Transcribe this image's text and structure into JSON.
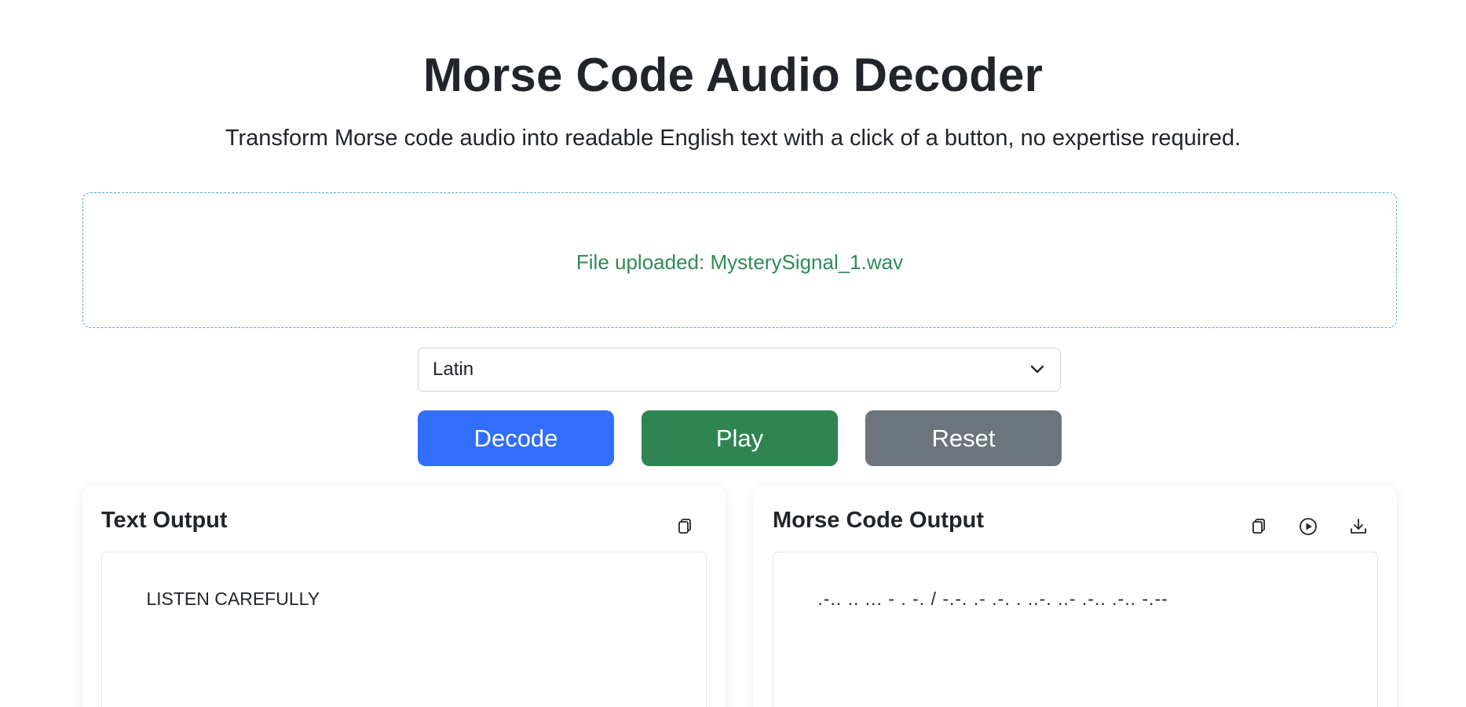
{
  "header": {
    "title": "Morse Code Audio Decoder",
    "subtitle": "Transform Morse code audio into readable English text with a click of a button, no expertise required."
  },
  "upload": {
    "status_text": "File uploaded: MysterySignal_1.wav",
    "status_color": "#2e8b57",
    "border_color": "#58a6e6"
  },
  "language_select": {
    "selected": "Latin",
    "icon": "chevron-down-icon"
  },
  "actions": {
    "decode_label": "Decode",
    "play_label": "Play",
    "reset_label": "Reset",
    "decode_color": "#316ffb",
    "play_color": "#2e8551",
    "reset_color": "#6c757d"
  },
  "text_output": {
    "title": "Text Output",
    "value": "LISTEN CAREFULLY",
    "icons": [
      "copy-icon"
    ]
  },
  "morse_output": {
    "title": "Morse Code Output",
    "value": ".-.. .. ... - . -. / -.-. .- .-. . ..-. ..- .-.. .-.. -.--",
    "icons": [
      "copy-icon",
      "play-circle-icon",
      "download-icon"
    ]
  }
}
